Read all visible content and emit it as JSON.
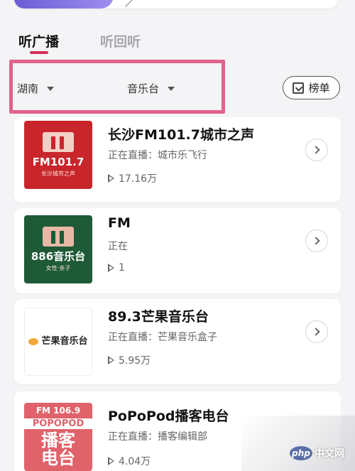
{
  "tabs": {
    "active": "听广播",
    "inactive": "听回听"
  },
  "filters": {
    "region": "湖南",
    "station_type": "音乐台",
    "rank_label": "榜单"
  },
  "stations": [
    {
      "title": "长沙FM101.7城市之声",
      "live": "正在直播：城市乐飞行",
      "plays": "17.16万",
      "logo_text": "FM101.7",
      "logo_sub": "长沙城市之声"
    },
    {
      "title": "FM",
      "live": "正在",
      "plays": "1",
      "logo_text": "886音乐台",
      "logo_sub": "女性·亲子"
    },
    {
      "title": "89.3芒果音乐台",
      "live": "正在直播：芒果音乐盒子",
      "plays": "5.95万",
      "logo_text": "芒果音乐台"
    },
    {
      "title": "PoPoPod播客电台",
      "live": "正在直播：播客编辑部",
      "plays": "4.04万",
      "logo_text": "FM 106.9",
      "logo_band": "POPOPOD",
      "logo_big1": "播客",
      "logo_big2": "电台"
    }
  ],
  "watermark": {
    "badge": "php",
    "site": "中文网"
  },
  "colors": {
    "tab_underline": "#d6315a",
    "highlight_border": "#e0628d"
  }
}
